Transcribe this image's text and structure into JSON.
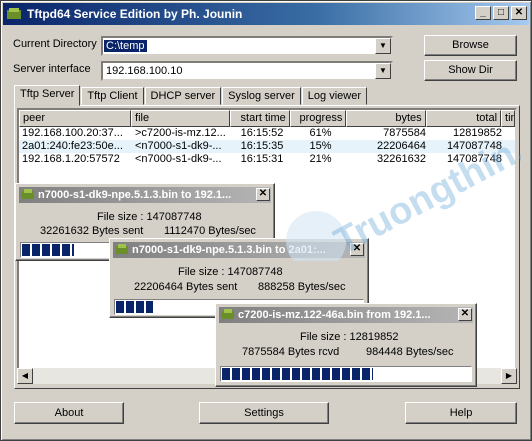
{
  "window": {
    "title": "Tftpd64 Service Edition by Ph. Jounin"
  },
  "form": {
    "current_directory_label": "Current Directory",
    "current_directory_value": "C:\\temp",
    "server_interface_label": "Server interface",
    "server_interface_value": "192.168.100.10",
    "browse_label": "Browse",
    "show_dir_label": "Show Dir"
  },
  "tabs": [
    {
      "label": "Tftp Server",
      "active": true
    },
    {
      "label": "Tftp Client",
      "active": false
    },
    {
      "label": "DHCP server",
      "active": false
    },
    {
      "label": "Syslog server",
      "active": false
    },
    {
      "label": "Log viewer",
      "active": false
    }
  ],
  "table": {
    "columns": [
      "peer",
      "file",
      "start time",
      "progress",
      "bytes",
      "total",
      "tim"
    ],
    "rows": [
      {
        "peer": "192.168.100.20:37...",
        "file": ">c7200-is-mz.12...",
        "start": "16:15:52",
        "progress": "61%",
        "bytes": "7875584",
        "total": "12819852"
      },
      {
        "peer": "2a01:240:fe23:50e...",
        "file": "<n7000-s1-dk9-...",
        "start": "16:15:35",
        "progress": "15%",
        "bytes": "22206464",
        "total": "147087748"
      },
      {
        "peer": "192.168.1.20:57572",
        "file": "<n7000-s1-dk9-...",
        "start": "16:15:31",
        "progress": "21%",
        "bytes": "32261632",
        "total": "147087748"
      }
    ]
  },
  "popups": [
    {
      "title": "n7000-s1-dk9-npe.5.1.3.bin to 192.1...",
      "file_size": "File size : 147087748",
      "bytes_line": "32261632 Bytes sent",
      "rate": "1112470 Bytes/sec",
      "progress": 0.21
    },
    {
      "title": "n7000-s1-dk9-npe.5.1.3.bin to 2a01:...",
      "file_size": "File size : 147087748",
      "bytes_line": "22206464 Bytes sent",
      "rate": "888258 Bytes/sec",
      "progress": 0.15
    },
    {
      "title": "c7200-is-mz.122-46a.bin from 192.1...",
      "file_size": "File size : 12819852",
      "bytes_line": "7875584 Bytes rcvd",
      "rate": "984448 Bytes/sec",
      "progress": 0.61
    }
  ],
  "buttons": {
    "about": "About",
    "settings": "Settings",
    "help": "Help"
  },
  "watermark": "Truongthin.com"
}
